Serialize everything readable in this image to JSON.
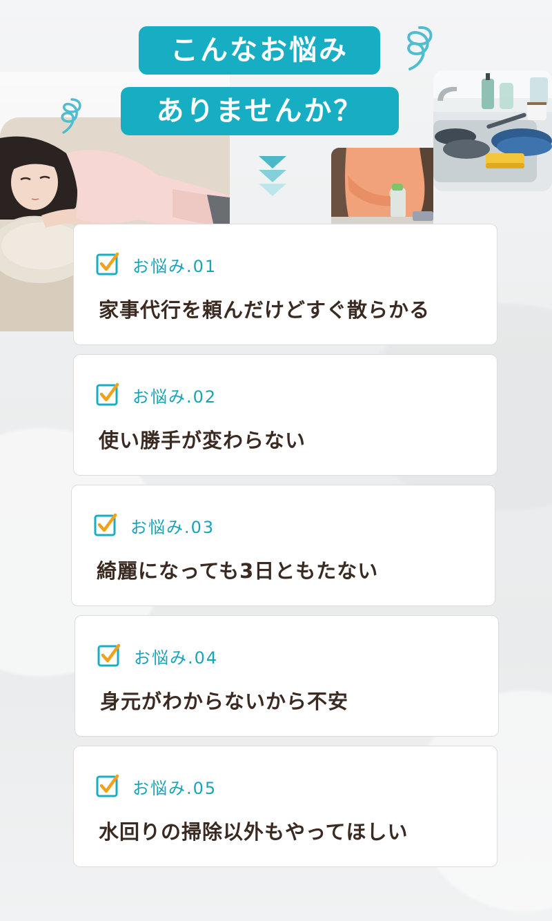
{
  "header": {
    "title_line1": "こんなお悩み",
    "title_line2": "ありませんか？"
  },
  "colors": {
    "accent": "#17aec4",
    "check_orange": "#f2a11c",
    "text_dark": "#3a2a22"
  },
  "images": {
    "woman": "woman-lying-on-sofa-photo",
    "sink": "dirty-dishes-in-sink-photo",
    "cleaning": "person-cleaning-with-spray-photo"
  },
  "worries": [
    {
      "tag": "お悩み.01",
      "text": "家事代行を頼んだけどすぐ散らかる"
    },
    {
      "tag": "お悩み.02",
      "text": "使い勝手が変わらない"
    },
    {
      "tag": "お悩み.03",
      "text": "綺麗になっても3日ともたない"
    },
    {
      "tag": "お悩み.04",
      "text": "身元がわからないから不安"
    },
    {
      "tag": "お悩み.05",
      "text": "水回りの掃除以外もやってほしい"
    }
  ]
}
